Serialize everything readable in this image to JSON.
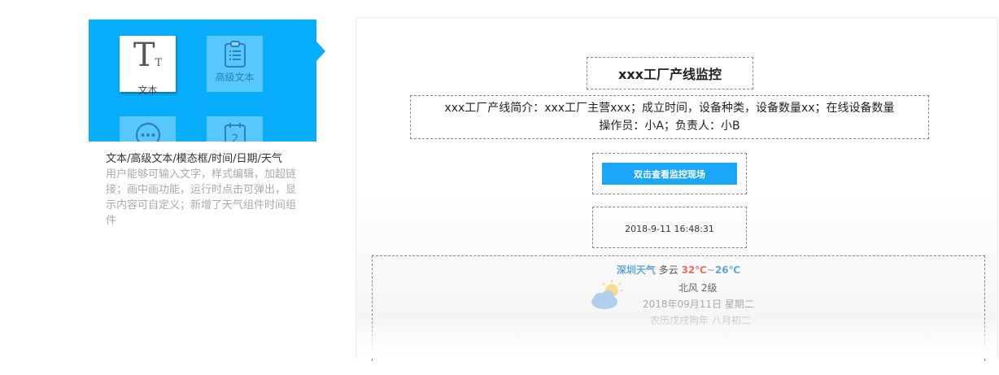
{
  "widgets": {
    "tiles": [
      {
        "label": "文本",
        "glyph_big": "T",
        "glyph_small": "T",
        "icon": "text-icon"
      },
      {
        "label": "高级文本",
        "icon": "clipboard-icon"
      },
      {
        "label": "",
        "icon": "chat-bubble-icon"
      },
      {
        "label": "",
        "icon": "calendar-icon"
      }
    ],
    "title": "文本/高级文本/模态框/时间/日期/天气",
    "description": "用户能够可输入文字，样式编辑，加超链接；画中画功能，运行时点击可弹出，显示内容可自定义；新增了天气组件时间组件",
    "accent_color": "#08adfb"
  },
  "canvas": {
    "title": "xxx工厂产线监控",
    "intro_line1": "xxx工厂产线简介：xxx工厂主营xxx；成立时间，设备种类，设备数量xx；在线设备数量",
    "intro_line2": "操作员：小A；负责人：小B",
    "button_label": "双击查看监控现场",
    "datetime": "2018-9-11 16:48:31",
    "weather": {
      "city": "深圳天气",
      "condition": "多云",
      "temp_high": "32℃",
      "temp_sep": "~",
      "temp_low": "26℃",
      "wind": "北风 2级",
      "date": "2018年09月11日 星期二",
      "lunar": "农历戊戌狗年 八月初二",
      "icon": "partly-cloudy-icon"
    }
  }
}
